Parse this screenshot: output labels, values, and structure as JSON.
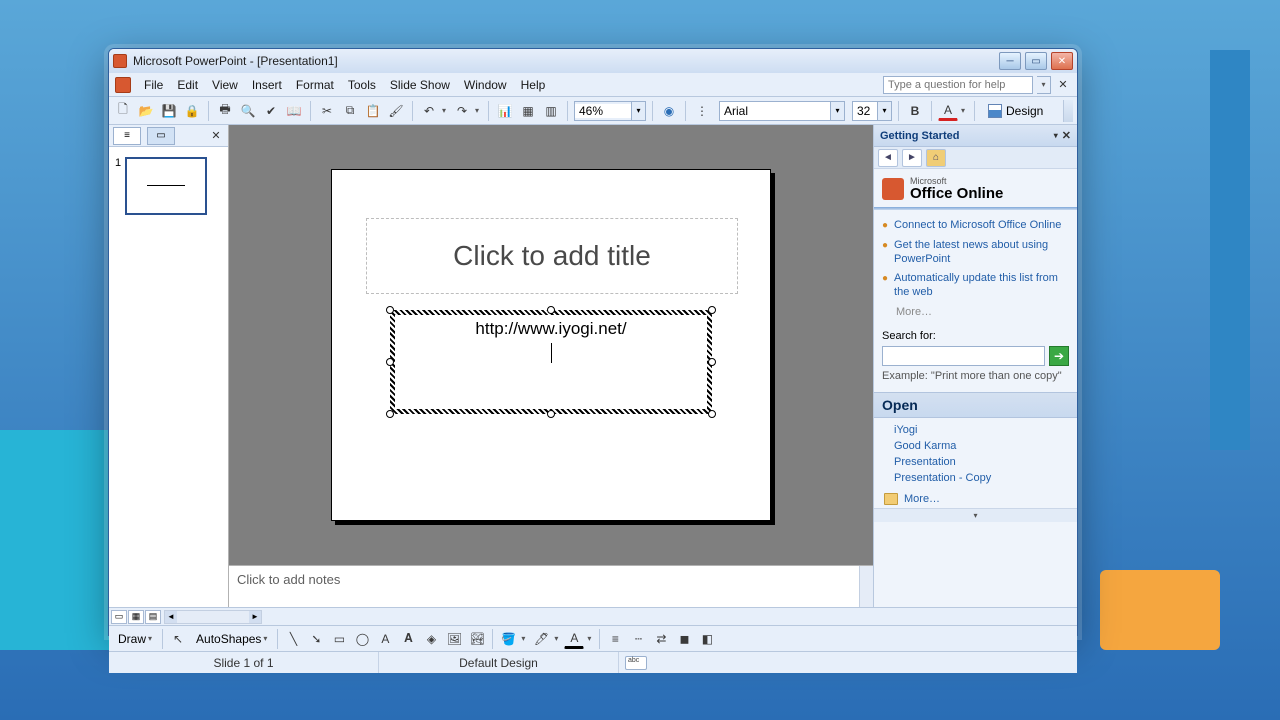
{
  "title": "Microsoft PowerPoint - [Presentation1]",
  "menu": {
    "file": "File",
    "edit": "Edit",
    "view": "View",
    "insert": "Insert",
    "format": "Format",
    "tools": "Tools",
    "slideshow": "Slide Show",
    "window": "Window",
    "help": "Help"
  },
  "helpbox": {
    "placeholder": "Type a question for help"
  },
  "toolbar": {
    "zoom": "46%",
    "font": "Arial",
    "size": "32",
    "design": "Design"
  },
  "outline": {
    "slide_num": "1"
  },
  "slide": {
    "title_placeholder": "Click to add title",
    "subtitle_text": "http://www.iyogi.net/"
  },
  "notes": {
    "placeholder": "Click to add notes"
  },
  "taskpane": {
    "header": "Getting Started",
    "online_small": "Microsoft",
    "online_big": "Office Online",
    "links": [
      "Connect to Microsoft Office Online",
      "Get the latest news about using PowerPoint",
      "Automatically update this list from the web"
    ],
    "links_more": "More…",
    "search_label": "Search for:",
    "search_example_lbl": "Example:",
    "search_example_val": "\"Print more than one copy\"",
    "open_header": "Open",
    "open_files": [
      "iYogi",
      "Good Karma",
      "Presentation",
      "Presentation - Copy"
    ],
    "open_more": "More…"
  },
  "drawbar": {
    "draw": "Draw",
    "autoshapes": "AutoShapes"
  },
  "status": {
    "slide": "Slide 1 of 1",
    "design": "Default Design"
  }
}
